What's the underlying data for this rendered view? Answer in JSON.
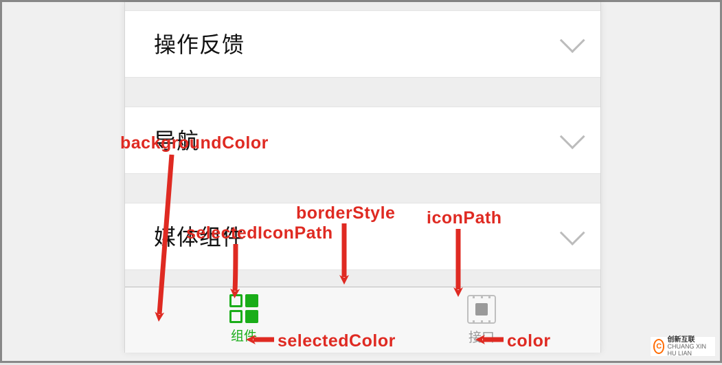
{
  "list_items": [
    {
      "label": "操作反馈"
    },
    {
      "label": "导航"
    },
    {
      "label": "媒体组件"
    }
  ],
  "tabbar": {
    "selected": {
      "label": "组件"
    },
    "unselected": {
      "label": "接口"
    }
  },
  "annotations": {
    "backgroundColor": "backgroundColor",
    "selectedIconPath": "selectedIconPath",
    "borderStyle": "borderStyle",
    "iconPath": "iconPath",
    "selectedColor": "selectedColor",
    "color": "color"
  },
  "watermark": {
    "brand": "创新互联",
    "sub": "CHUANG XIN HU LIAN",
    "mark": "C"
  }
}
